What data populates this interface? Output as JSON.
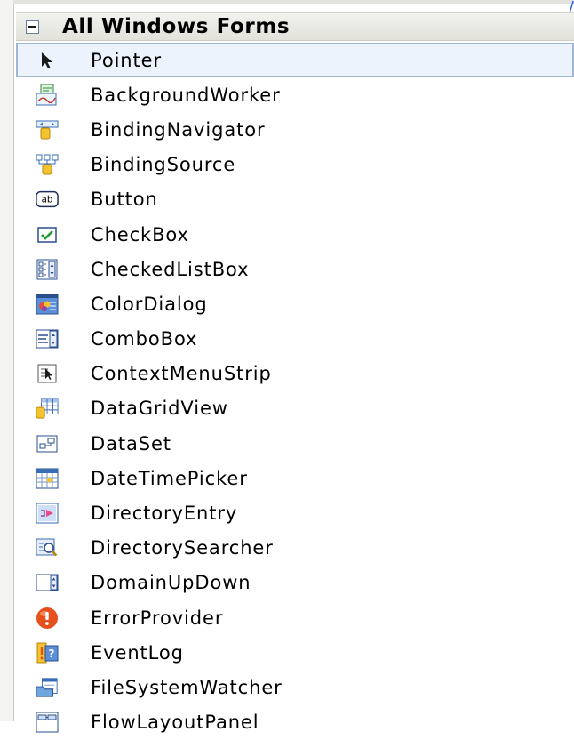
{
  "toolbox": {
    "corner_glyph": "/",
    "group": {
      "title": "All Windows Forms",
      "expanded": true
    },
    "items": [
      {
        "label": "Pointer",
        "icon": "pointer-icon",
        "selected": true
      },
      {
        "label": "BackgroundWorker",
        "icon": "background-worker-icon"
      },
      {
        "label": "BindingNavigator",
        "icon": "binding-navigator-icon"
      },
      {
        "label": "BindingSource",
        "icon": "binding-source-icon"
      },
      {
        "label": "Button",
        "icon": "button-icon"
      },
      {
        "label": "CheckBox",
        "icon": "checkbox-icon"
      },
      {
        "label": "CheckedListBox",
        "icon": "checked-listbox-icon"
      },
      {
        "label": "ColorDialog",
        "icon": "color-dialog-icon"
      },
      {
        "label": "ComboBox",
        "icon": "combobox-icon"
      },
      {
        "label": "ContextMenuStrip",
        "icon": "context-menu-strip-icon"
      },
      {
        "label": "DataGridView",
        "icon": "data-grid-view-icon"
      },
      {
        "label": "DataSet",
        "icon": "dataset-icon"
      },
      {
        "label": "DateTimePicker",
        "icon": "date-time-picker-icon"
      },
      {
        "label": "DirectoryEntry",
        "icon": "directory-entry-icon"
      },
      {
        "label": "DirectorySearcher",
        "icon": "directory-searcher-icon"
      },
      {
        "label": "DomainUpDown",
        "icon": "domain-up-down-icon"
      },
      {
        "label": "ErrorProvider",
        "icon": "error-provider-icon"
      },
      {
        "label": "EventLog",
        "icon": "event-log-icon"
      },
      {
        "label": "FileSystemWatcher",
        "icon": "file-system-watcher-icon"
      },
      {
        "label": "FlowLayoutPanel",
        "icon": "flow-layout-panel-icon"
      }
    ]
  },
  "colors": {
    "selection_fill": "#ecf3fc",
    "selection_border": "#9fb6d4",
    "header_fill": "#e8e8e2"
  }
}
